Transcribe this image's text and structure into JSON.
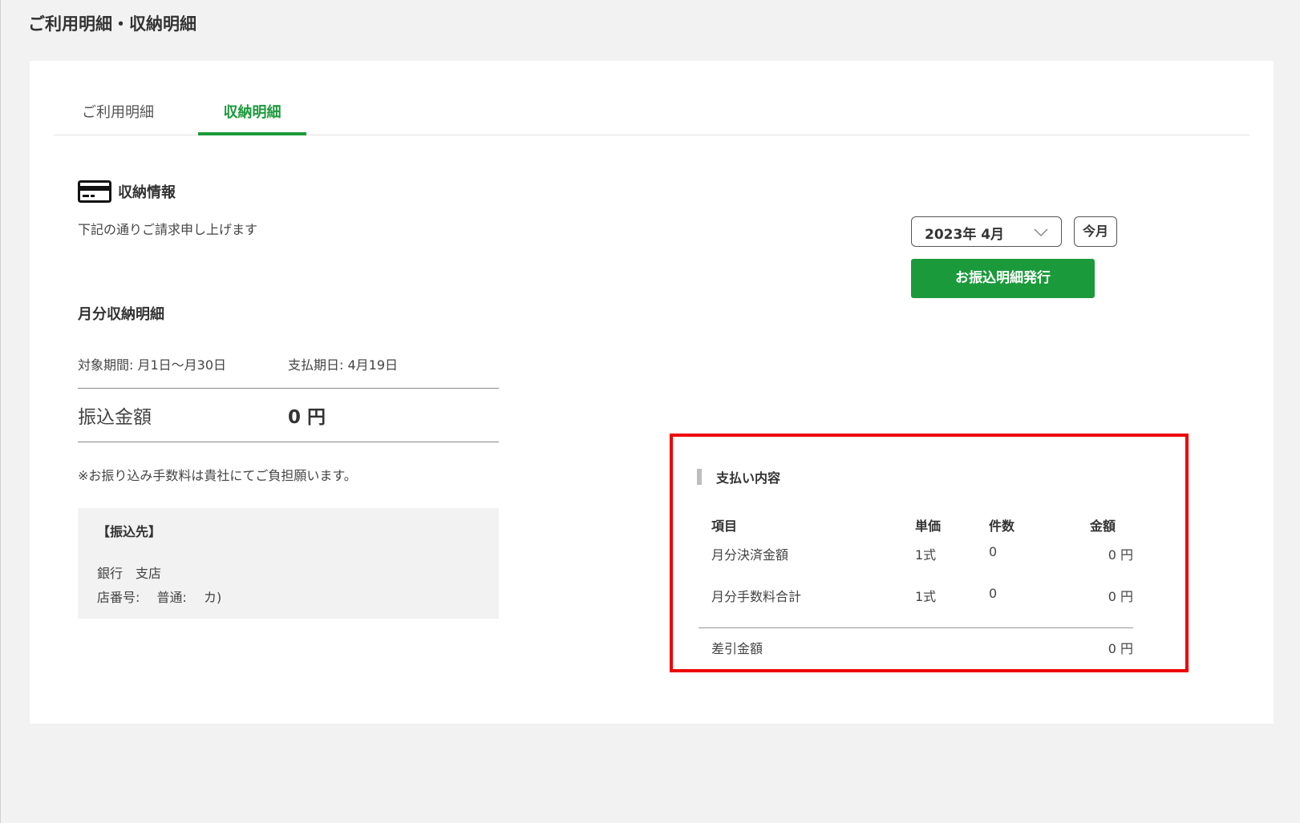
{
  "page": {
    "title": "ご利用明細・収納明細"
  },
  "tabs": [
    {
      "label": "ご利用明細",
      "active": false
    },
    {
      "label": "収納明細",
      "active": true
    }
  ],
  "section": {
    "icon": "credit-card-icon",
    "title": "収納情報",
    "subtitle": "下記の通りご請求申し上げます"
  },
  "controls": {
    "month_value": "2023年 4月",
    "this_month_label": "今月",
    "issue_button_label": "お振込明細発行"
  },
  "monthly": {
    "title": "月分収納明細",
    "period": "対象期間: 月1日～月30日",
    "due": "支払期日: 4月19日",
    "amount_label": "振込金額",
    "amount_value": "0 円",
    "fee_note": "※お振り込み手数料は貴社にてご負担願います。"
  },
  "bank": {
    "heading": "【振込先】",
    "line1": "銀行　支店",
    "line2": "店番号:　 普通:　 カ)"
  },
  "payment": {
    "title": "支払い内容",
    "headers": {
      "item": "項目",
      "unit": "単価",
      "count": "件数",
      "amount": "金額"
    },
    "rows": [
      {
        "item": "月分決済金額",
        "unit": "1式",
        "count": "0",
        "amount": "0 円"
      },
      {
        "item": "月分手数料合計",
        "unit": "1式",
        "count": "0",
        "amount": "0 円"
      }
    ],
    "total": {
      "label": "差引金額",
      "amount": "0 円"
    }
  },
  "colors": {
    "accent_green": "#1b9a3b",
    "highlight_red": "#ee0000",
    "background": "#f2f2f2"
  }
}
